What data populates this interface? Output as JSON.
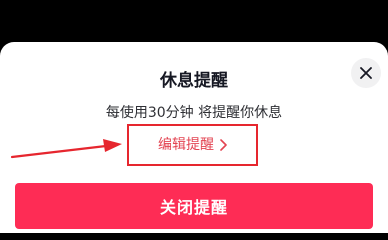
{
  "dialog": {
    "title": "休息提醒",
    "subtitle": "每使用30分钟 将提醒你休息",
    "edit_link_label": "编辑提醒",
    "primary_button_label": "关闭提醒"
  },
  "colors": {
    "background": "#000000",
    "sheet": "#ffffff",
    "primary": "#fe2c55",
    "link": "#e34452",
    "annotation": "#e6262e"
  },
  "icons": {
    "close": "close-icon",
    "chevron": "chevron-right-icon",
    "annotation_arrow": "arrow-right-icon"
  }
}
